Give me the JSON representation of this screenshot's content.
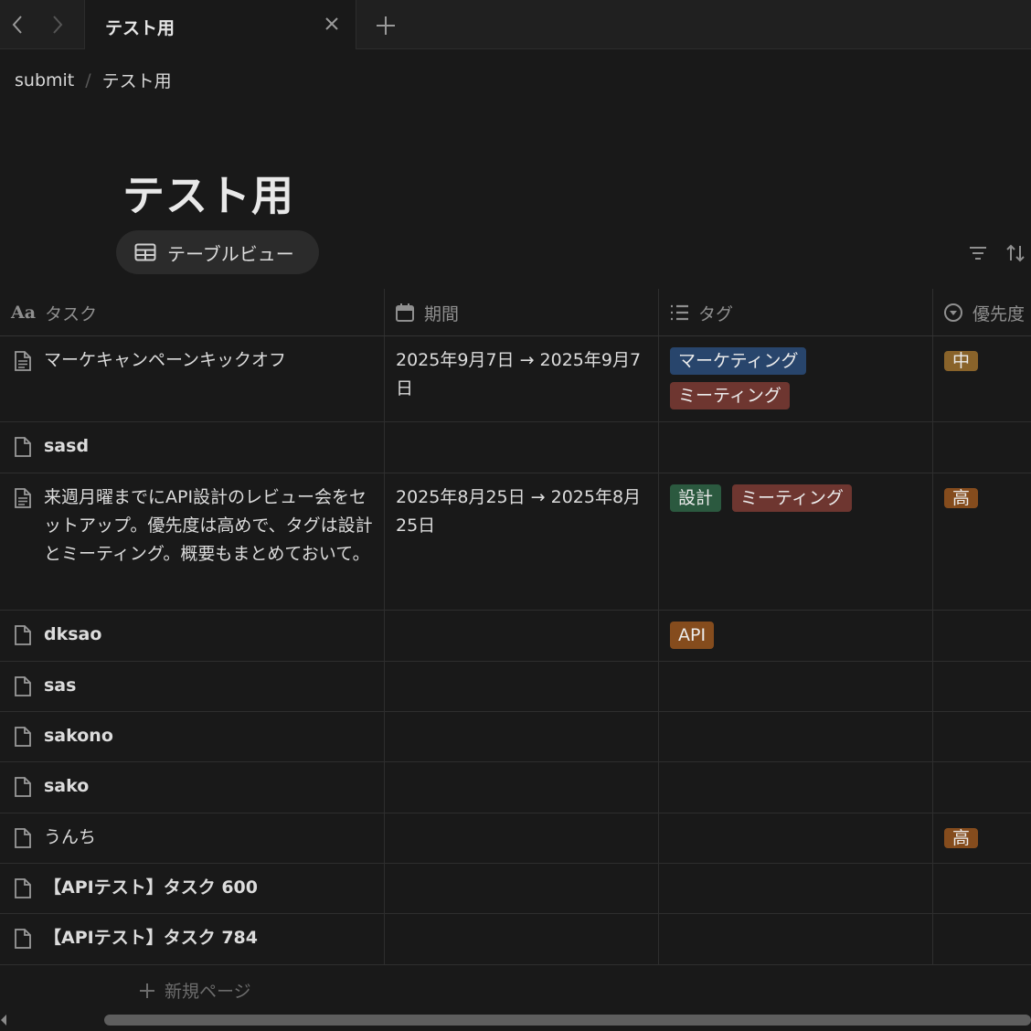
{
  "tabbar": {
    "tab_title": "テスト用",
    "icons": {
      "back": "chevron-left-icon",
      "forward": "chevron-right-icon",
      "close": "close-icon",
      "new_tab": "plus-icon"
    }
  },
  "breadcrumb": {
    "items": [
      "submit",
      "テスト用"
    ],
    "separator": "/"
  },
  "page": {
    "title": "テスト用",
    "view_label": "テーブルビュー"
  },
  "table": {
    "columns": [
      {
        "label": "タスク",
        "icon": "text-property-icon",
        "icon_text": "Aa"
      },
      {
        "label": "期間",
        "icon": "calendar-icon"
      },
      {
        "label": "タグ",
        "icon": "list-icon"
      },
      {
        "label": "優先度",
        "icon": "status-icon"
      }
    ],
    "rows": [
      {
        "task": "マーケキャンペーンキックオフ",
        "date": "2025年9月7日 → 2025年9月7日",
        "tags": [
          "マーケティング",
          "ミーティング"
        ],
        "priority": "中"
      },
      {
        "task": "sasd",
        "date": "",
        "tags": [],
        "priority": ""
      },
      {
        "task": "来週月曜までにAPI設計のレビュー会をセットアップ。優先度は高めで、タグは設計とミーティング。概要もまとめておいて。",
        "date": "2025年8月25日 → 2025年8月25日",
        "tags": [
          "設計",
          "ミーティング"
        ],
        "priority": "高"
      },
      {
        "task": "dksao",
        "date": "",
        "tags": [
          "API"
        ],
        "priority": ""
      },
      {
        "task": "sas",
        "date": "",
        "tags": [],
        "priority": ""
      },
      {
        "task": "sakono",
        "date": "",
        "tags": [],
        "priority": ""
      },
      {
        "task": "sako",
        "date": "",
        "tags": [],
        "priority": ""
      },
      {
        "task": "うんち",
        "date": "",
        "tags": [],
        "priority": "高"
      },
      {
        "task": "【APIテスト】タスク 600",
        "date": "",
        "tags": [],
        "priority": ""
      },
      {
        "task": "【APIテスト】タスク 784",
        "date": "",
        "tags": [],
        "priority": ""
      }
    ],
    "new_page_label": "新規ページ"
  },
  "tag_colors": {
    "マーケティング": "#28456c",
    "ミーティング": "#6e3630",
    "設計": "#2b593f",
    "API": "#854c1d",
    "中": "#89632a",
    "高": "#854c1d"
  }
}
